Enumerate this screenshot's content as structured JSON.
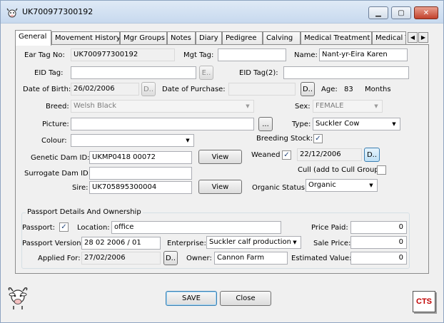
{
  "window": {
    "title": "UK700977300192"
  },
  "tabs": [
    {
      "label": "General"
    },
    {
      "label": "Movement History"
    },
    {
      "label": "Mgr Groups"
    },
    {
      "label": "Notes"
    },
    {
      "label": "Diary"
    },
    {
      "label": "Pedigree"
    },
    {
      "label": "Calving"
    },
    {
      "label": "Medical Treatment"
    },
    {
      "label": "Medical T"
    }
  ],
  "general": {
    "ear_tag_label": "Ear Tag No:",
    "ear_tag_value": "UK700977300192",
    "mgt_tag_label": "Mgt Tag:",
    "mgt_tag_value": "",
    "name_label": "Name:",
    "name_value": "Nant-yr-Eira Karen",
    "eid_tag_label": "EID Tag:",
    "eid_tag_value": "",
    "eid_btn": "E..",
    "eid_tag2_label": "EID Tag(2):",
    "eid_tag2_value": "",
    "dob_label": "Date of Birth:",
    "dob_value": "26/02/2006",
    "date_btn": "D..",
    "dop_label": "Date of Purchase:",
    "dop_value": "",
    "age_label": "Age:",
    "age_value": "83",
    "age_unit": "Months",
    "breed_label": "Breed:",
    "breed_value": "Welsh Black",
    "sex_label": "Sex:",
    "sex_value": "FEMALE",
    "picture_label": "Picture:",
    "picture_value": "",
    "browse_btn": "...",
    "type_label": "Type:",
    "type_value": "Suckler Cow",
    "colour_label": "Colour:",
    "colour_value": "",
    "breeding_stock_label": "Breeding Stock:",
    "breeding_stock_checked": "✓",
    "genetic_dam_label": "Genetic Dam ID:",
    "genetic_dam_value": "UKMP0418 00072",
    "view_btn": "View",
    "weaned_label": "Weaned",
    "weaned_checked": "✓",
    "weaned_date": "22/12/2006",
    "surrogate_dam_label": "Surrogate Dam ID:",
    "surrogate_dam_value": "",
    "cull_label": "Cull (add to Cull Group)",
    "cull_checked": "",
    "sire_label": "Sire:",
    "sire_value": "UK705895300004",
    "organic_label": "Organic Status:",
    "organic_value": "Organic"
  },
  "passport": {
    "group_title": "Passport Details And Ownership",
    "passport_label": "Passport:",
    "passport_checked": "✓",
    "location_label": "Location:",
    "location_value": "office",
    "price_paid_label": "Price Paid:",
    "price_paid_value": "0",
    "version_label": "Passport Version:",
    "version_value": "28 02 2006 / 01",
    "enterprise_label": "Enterprise:",
    "enterprise_value": "Suckler calf production",
    "sale_price_label": "Sale Price:",
    "sale_price_value": "0",
    "applied_label": "Applied For:",
    "applied_value": "27/02/2006",
    "owner_label": "Owner:",
    "owner_value": "Cannon Farm",
    "est_value_label": "Estimated Value:",
    "est_value_value": "0"
  },
  "footer": {
    "save_label": "SAVE",
    "close_label": "Close",
    "cts_logo": "CTS"
  }
}
